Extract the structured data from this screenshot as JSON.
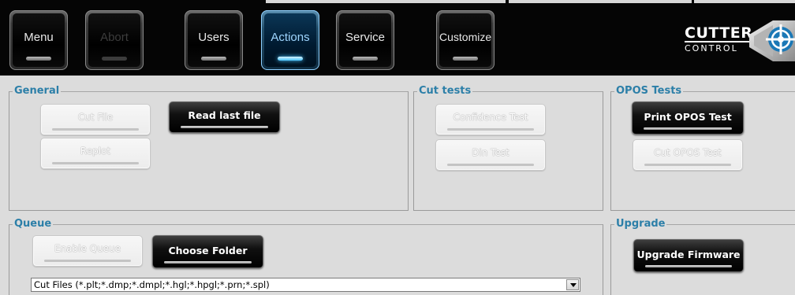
{
  "toolbar": {
    "buttons": [
      {
        "label": "Menu",
        "state": "normal"
      },
      {
        "label": "Abort",
        "state": "disabled"
      },
      {
        "label": "Users",
        "state": "normal"
      },
      {
        "label": "Actions",
        "state": "active"
      },
      {
        "label": "Service",
        "state": "normal"
      },
      {
        "label": "Customize",
        "state": "normal"
      }
    ],
    "active_color": "#49c5ff"
  },
  "logo": {
    "line1": "CUTTER",
    "line2": "CONTROL"
  },
  "general": {
    "title": "General",
    "cut_file": "Cut File",
    "read_last_file": "Read last file",
    "replot": "Replot"
  },
  "cut_tests": {
    "title": "Cut tests",
    "confidence_test": "Confidence Test",
    "din_test": "Din Test"
  },
  "opos_tests": {
    "title": "OPOS Tests",
    "print_opos_test": "Print OPOS Test",
    "cut_opos_test": "Cut OPOS Test"
  },
  "queue": {
    "title": "Queue",
    "enable_queue": "Enable Queue",
    "choose_folder": "Choose Folder",
    "file_filter": "Cut Files (*.plt;*.dmp;*.dmpl;*.hgl;*.hpgl;*.prn;*.spl)"
  },
  "upgrade": {
    "title": "Upgrade",
    "upgrade_firmware": "Upgrade Firmware"
  },
  "colors": {
    "section_title": "#2c7fa8",
    "background": "#dcdcdc"
  },
  "icons": {
    "logo_emblem": "crosshair-emblem-icon",
    "dropdown": "chevron-down-icon"
  }
}
